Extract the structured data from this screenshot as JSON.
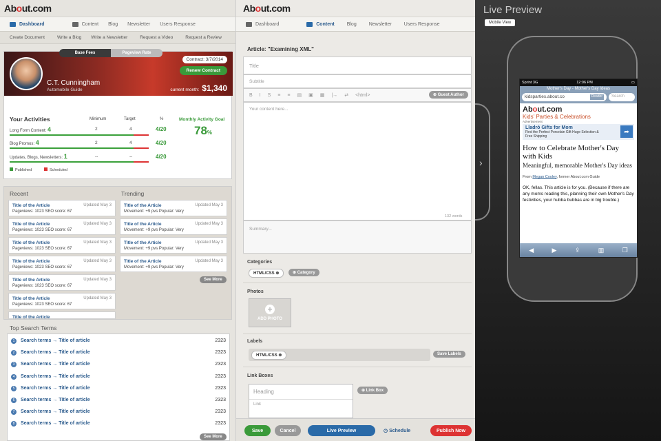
{
  "left": {
    "logo": {
      "pre": "Ab",
      "dot": "o",
      "post": "ut.com"
    },
    "nav": [
      "Dashboard",
      "Content",
      "Blog",
      "Newsletter",
      "Users Response"
    ],
    "subnav": [
      "Create Document",
      "Write a Blog",
      "Write a Newsletter",
      "Request a Video",
      "Request a Review"
    ],
    "profile": {
      "contract": "Contract: 3/7/2014",
      "renew": "Renew Contract",
      "name": "C.T. Cunningham",
      "role": "Automobile Guide",
      "current_month_label": "current month:",
      "current_month_value": "$1,340"
    },
    "toggle": [
      "Base Fees",
      "Pageview Rate"
    ],
    "activities": {
      "title": "Your Activities",
      "headers": [
        "Minimum",
        "Target",
        "%"
      ],
      "rows": [
        {
          "label": "Long Form Content:",
          "count": "4",
          "min": "2",
          "target": "4",
          "pct": "4/20"
        },
        {
          "label": "Blog Promos:",
          "count": "4",
          "min": "2",
          "target": "4",
          "pct": "4/20"
        },
        {
          "label": "Updates, Blogs, Newsletters:",
          "count": "1",
          "min": "--",
          "target": "--",
          "pct": "4/20"
        }
      ],
      "legend": [
        "Published",
        "Scheduled"
      ],
      "goal_label": "Monthly Activity Goal",
      "goal_value": "78",
      "goal_unit": "%"
    },
    "recent_title": "Recent",
    "trending_title": "Trending",
    "article_title": "Title of the Article",
    "updated": "Updated May 3",
    "recent_meta": "Pageviews: 1023     SEO score: 67",
    "trending_meta": "Movement: +9 pvs     Popular: Very",
    "see_more": "See More",
    "search_title": "Top Search Terms",
    "search_term": "Search terms → Title of article",
    "search_count": "2323",
    "search_numbers": [
      "1",
      "2",
      "3",
      "4",
      "5",
      "6",
      "7",
      "8"
    ]
  },
  "editor": {
    "logo": {
      "pre": "Ab",
      "dot": "o",
      "post": "ut.com"
    },
    "nav": [
      "Dashboard",
      "Content",
      "Blog",
      "Newsletter",
      "Users Response"
    ],
    "article": "Article: \"Examining XML\"",
    "title_ph": "Title",
    "subtitle_ph": "Subtitle",
    "guest_author": "Guest Author",
    "toolbar": [
      "B",
      "I",
      "S",
      "≡",
      "≡",
      "▤",
      "▣",
      "▦",
      "|→",
      "⇄",
      "<html>"
    ],
    "content_ph": "Your content here...",
    "word_count": "132 words",
    "summary_ph": "Summary...",
    "categories_label": "Categories",
    "category_tag": "HTML/CSS",
    "category_add": "Category",
    "photos_label": "Photos",
    "add_photo": "ADD PHOTO",
    "labels_label": "Labels",
    "label_tag": "HTML/CSS",
    "save_labels": "Save Labels",
    "link_boxes_label": "Link Boxes",
    "heading_ph": "Heading",
    "link_ph": "Link",
    "link_box": "Link Box",
    "save": "Save",
    "cancel": "Cancel",
    "live_preview": "Live Preview",
    "schedule": "Schedule",
    "publish": "Publish Now"
  },
  "preview": {
    "title": "Live Preview",
    "mobile_view": "Mobile View",
    "status": {
      "carrier": "Sprint  3G",
      "time": "12:06 PM"
    },
    "page_title": "Mother's Day - Mother's Day Ideas",
    "url": "kidsparties.about.co",
    "reader": "Reader",
    "search": "Search",
    "site_logo": {
      "pre": "Ab",
      "dot": "o",
      "post": "ut.com"
    },
    "site_section": "Kids' Parties & Celebrations",
    "ad_label": "Advertisement",
    "ad_title": "Lladró Gifts for Mom",
    "ad_line1": "Find the Perfect Porcelain Gift Huge Selection &",
    "ad_line2": "Free Shipping",
    "headline": "How to Celebrate Mother's Day with Kids",
    "subhead": "Meaningful, memorable Mother's Day ideas",
    "from": "From",
    "author": "Megan Cooley",
    "author_role": ", former About.com Guide",
    "body_text": "OK, fellas. This article is for you. (Because if there are any moms reading this, planning their own Mother's Day festivities, your hubba bubbas are in big trouble.)"
  },
  "colors": {
    "accent": "#2a5a8c",
    "green": "#3a9a3a",
    "red": "#d33333"
  }
}
